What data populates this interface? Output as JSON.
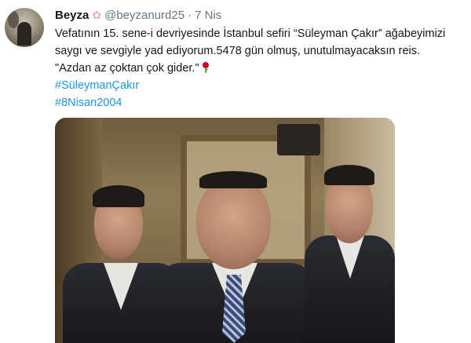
{
  "tweet": {
    "author": {
      "name": "Beyza",
      "handle": "@beyzanurd25",
      "badge_icon": "flower-icon",
      "avatar_icon": "avatar"
    },
    "separator": "·",
    "date": "7 Nis",
    "lines": [
      "Vefatının 15. sene-i devriyesinde İstanbul sefiri “Süleyman Çakır” ağabeyimizi",
      "saygı ve sevgiyle yad ediyorum.5478 gün olmuş, unutulmayacaksın reis.",
      "\"Azdan az çoktan çok gider.\""
    ],
    "emoji_icon": "rose-icon",
    "hashtags": [
      "#SüleymanÇakır",
      "#8Nisan2004"
    ],
    "media": {
      "type": "photo"
    }
  },
  "colors": {
    "hashtag": "#1b95e0",
    "muted": "#657786",
    "text": "#14171a"
  }
}
